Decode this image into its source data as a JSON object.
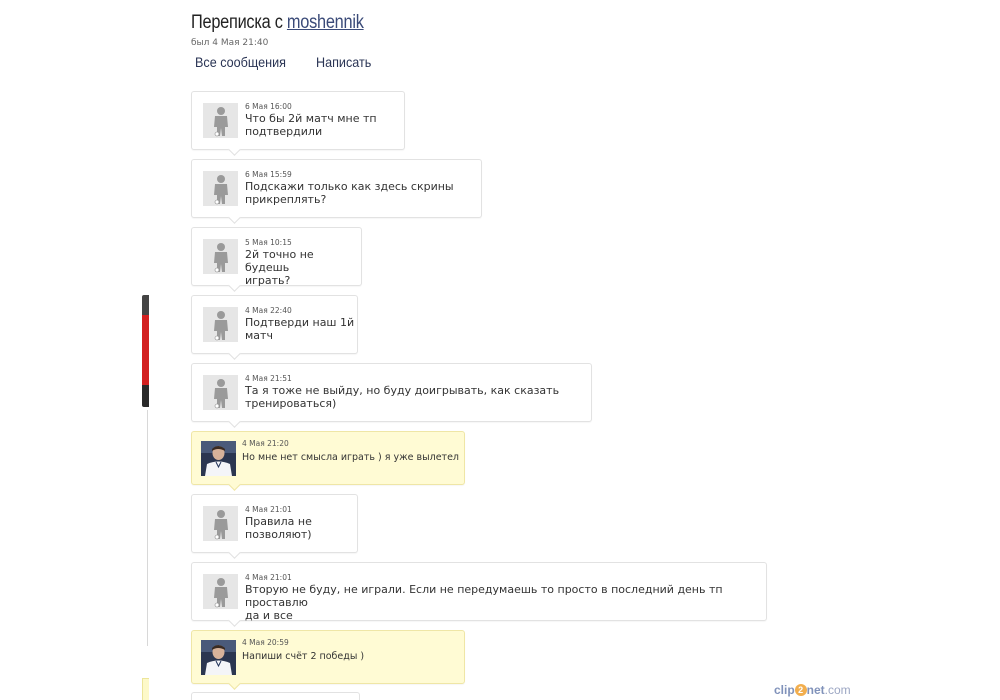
{
  "header": {
    "title_prefix": "Переписка с",
    "username": "moshennik",
    "last_seen": "был 4 Мая 21:40"
  },
  "tabs": [
    {
      "label": "Все сообщения"
    },
    {
      "label": "Написать"
    }
  ],
  "messages": [
    {
      "time": "6 Мая 16:00",
      "text": "Что бы 2й матч мне тп\nподтвердили",
      "mine": false
    },
    {
      "time": "6 Мая 15:59",
      "text": "Подскажи только как здесь скрины\nприкреплять?",
      "mine": false
    },
    {
      "time": "5 Мая 10:15",
      "text": "2й точно не будешь\nиграть?",
      "mine": false
    },
    {
      "time": "4 Мая 22:40",
      "text": "Подтверди наш 1й\nматч",
      "mine": false
    },
    {
      "time": "4 Мая 21:51",
      "text": "Та я тоже не выйду, но буду доигрывать, как сказать\nтренироваться)",
      "mine": false
    },
    {
      "time": "4 Мая 21:20",
      "text": "Но мне нет смысла играть ) я уже вылетел",
      "mine": true
    },
    {
      "time": "4 Мая 21:01",
      "text": "Правила не\nпозволяют)",
      "mine": false
    },
    {
      "time": "4 Мая 21:01",
      "text": "Вторую не буду, не играли. Если не передумаешь то просто в последний день тп проставлю\nда и все",
      "mine": false
    },
    {
      "time": "4 Мая 20:59",
      "text": "Напиши счёт 2 победы )",
      "mine": true
    }
  ],
  "watermark": {
    "part1": "clip",
    "part2": "2",
    "part3": "net",
    "part4": ".com"
  },
  "colors": {
    "own_message_bg": "#fffbd4",
    "link": "#3a4a78"
  },
  "icons": {
    "other_avatar": "silhouette-avatar-icon",
    "own_avatar": "user-photo-avatar"
  }
}
